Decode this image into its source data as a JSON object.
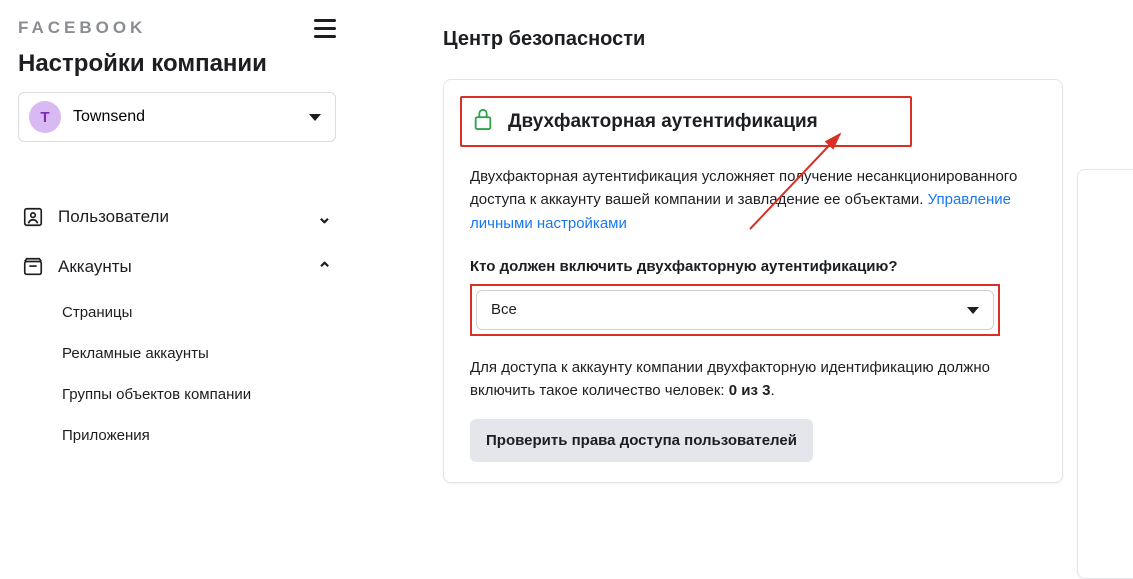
{
  "brand": "FACEBOOK",
  "sidebar": {
    "page_title": "Настройки компании",
    "company_initial": "T",
    "company_name": "Townsend",
    "sections": [
      {
        "label": "Пользователи",
        "expanded": false
      },
      {
        "label": "Аккаунты",
        "expanded": true
      }
    ],
    "accounts_items": [
      "Страницы",
      "Рекламные аккаунты",
      "Группы объектов компании",
      "Приложения"
    ]
  },
  "main": {
    "title": "Центр безопасности",
    "card": {
      "heading": "Двухфакторная аутентификация",
      "desc_part1": "Двухфакторная аутентификация усложняет получение несанкционированного доступа к аккаунту вашей компании и завладение ее объектами. ",
      "desc_link": "Управление личными настройками",
      "question": "Кто должен включить двухфакторную аутентификацию?",
      "select_value": "Все",
      "info_prefix": "Для доступа к аккаунту компании двухфакторную идентификацию должно включить такое количество человек: ",
      "info_bold": "0 из 3",
      "info_suffix": ".",
      "check_button": "Проверить права доступа пользователей"
    }
  },
  "annotation": {
    "color": "#d93025"
  }
}
